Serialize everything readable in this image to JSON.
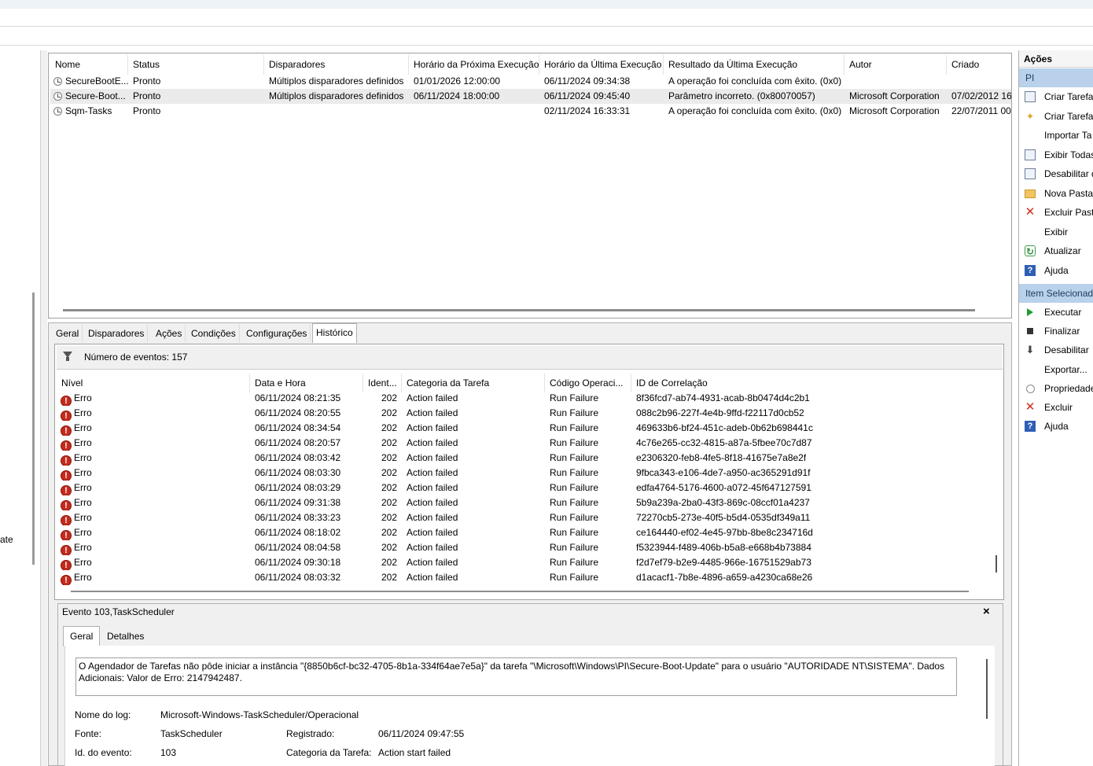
{
  "left_pane": {
    "partial_label": "ate"
  },
  "task_table": {
    "columns": [
      "Nome",
      "Status",
      "Disparadores",
      "Horário da Próxima Execução",
      "Horário da Última Execução",
      "Resultado da Última Execução",
      "Autor",
      "Criado"
    ],
    "rows": [
      {
        "name": "SecureBootE...",
        "status": "Pronto",
        "triggers": "Múltiplos disparadores definidos",
        "next_run": "01/01/2026 12:00:00",
        "last_run": "06/11/2024 09:34:38",
        "last_result": "A operação foi concluída com êxito. (0x0)",
        "author": "",
        "created": ""
      },
      {
        "name": "Secure-Boot...",
        "status": "Pronto",
        "triggers": "Múltiplos disparadores definidos",
        "next_run": "06/11/2024 18:00:00",
        "last_run": "06/11/2024 09:45:40",
        "last_result": "Parâmetro incorreto. (0x80070057)",
        "author": "Microsoft Corporation",
        "created": "07/02/2012 16:"
      },
      {
        "name": "Sqm-Tasks",
        "status": "Pronto",
        "triggers": "",
        "next_run": "",
        "last_run": "02/11/2024 16:33:31",
        "last_result": "A operação foi concluída com êxito. (0x0)",
        "author": "Microsoft Corporation",
        "created": "22/07/2011 00:"
      }
    ]
  },
  "detail_tabs": [
    "Geral",
    "Disparadores",
    "Ações",
    "Condições",
    "Configurações",
    "Histórico"
  ],
  "history": {
    "event_count_label": "Número de eventos: 157",
    "columns": [
      "Nível",
      "Data e Hora",
      "Ident...",
      "Categoria da Tarefa",
      "Código Operaci...",
      "ID de Correlação"
    ],
    "rows": [
      {
        "level": "Erro",
        "datetime": "06/11/2024 08:21:35",
        "id": "202",
        "category": "Action failed",
        "opcode": "Run Failure",
        "correlation": "8f36fcd7-ab74-4931-acab-8b0474d4c2b1"
      },
      {
        "level": "Erro",
        "datetime": "06/11/2024 08:20:55",
        "id": "202",
        "category": "Action failed",
        "opcode": "Run Failure",
        "correlation": "088c2b96-227f-4e4b-9ffd-f22117d0cb52"
      },
      {
        "level": "Erro",
        "datetime": "06/11/2024 08:34:54",
        "id": "202",
        "category": "Action failed",
        "opcode": "Run Failure",
        "correlation": "469633b6-bf24-451c-adeb-0b62b698441c"
      },
      {
        "level": "Erro",
        "datetime": "06/11/2024 08:20:57",
        "id": "202",
        "category": "Action failed",
        "opcode": "Run Failure",
        "correlation": "4c76e265-cc32-4815-a87a-5fbee70c7d87"
      },
      {
        "level": "Erro",
        "datetime": "06/11/2024 08:03:42",
        "id": "202",
        "category": "Action failed",
        "opcode": "Run Failure",
        "correlation": "e2306320-feb8-4fe5-8f18-41675e7a8e2f"
      },
      {
        "level": "Erro",
        "datetime": "06/11/2024 08:03:30",
        "id": "202",
        "category": "Action failed",
        "opcode": "Run Failure",
        "correlation": "9fbca343-e106-4de7-a950-ac365291d91f"
      },
      {
        "level": "Erro",
        "datetime": "06/11/2024 08:03:29",
        "id": "202",
        "category": "Action failed",
        "opcode": "Run Failure",
        "correlation": "edfa4764-5176-4600-a072-45f647127591"
      },
      {
        "level": "Erro",
        "datetime": "06/11/2024 09:31:38",
        "id": "202",
        "category": "Action failed",
        "opcode": "Run Failure",
        "correlation": "5b9a239a-2ba0-43f3-869c-08ccf01a4237"
      },
      {
        "level": "Erro",
        "datetime": "06/11/2024 08:33:23",
        "id": "202",
        "category": "Action failed",
        "opcode": "Run Failure",
        "correlation": "72270cb5-273e-40f5-b5d4-0535df349a11"
      },
      {
        "level": "Erro",
        "datetime": "06/11/2024 08:18:02",
        "id": "202",
        "category": "Action failed",
        "opcode": "Run Failure",
        "correlation": "ce164440-ef02-4e45-97bb-8be8c234716d"
      },
      {
        "level": "Erro",
        "datetime": "06/11/2024 08:04:58",
        "id": "202",
        "category": "Action failed",
        "opcode": "Run Failure",
        "correlation": "f5323944-f489-406b-b5a8-e668b4b73884"
      },
      {
        "level": "Erro",
        "datetime": "06/11/2024 09:30:18",
        "id": "202",
        "category": "Action failed",
        "opcode": "Run Failure",
        "correlation": "f2d7ef79-b2e9-4485-966e-16751529ab73"
      },
      {
        "level": "Erro",
        "datetime": "06/11/2024 08:03:32",
        "id": "202",
        "category": "Action failed",
        "opcode": "Run Failure",
        "correlation": "d1acacf1-7b8e-4896-a659-a4230ca68e26"
      }
    ]
  },
  "event_panel": {
    "title": "Evento 103,TaskScheduler",
    "close": "×",
    "tabs": [
      "Geral",
      "Detalhes"
    ],
    "message": "O Agendador de Tarefas não pôde iniciar a instância \"{8850b6cf-bc32-4705-8b1a-334f64ae7e5a}\" da tarefa \"\\Microsoft\\Windows\\PI\\Secure-Boot-Update\" para o usuário \"AUTORIDADE NT\\SISTEMA\". Dados Adicionais: Valor de Erro: 2147942487.",
    "log_name_label": "Nome do log:",
    "log_name": "Microsoft-Windows-TaskScheduler/Operacional",
    "source_label": "Fonte:",
    "source": "TaskScheduler",
    "logged_label": "Registrado:",
    "logged": "06/11/2024 09:47:55",
    "event_id_label": "Id. do evento:",
    "event_id": "103",
    "task_category_label": "Categoria da Tarefa:",
    "task_category": "Action start failed"
  },
  "actions_pane": {
    "header": "Ações",
    "section1": "PI",
    "section1_items": [
      {
        "label": "Criar Tarefa",
        "icon": "task-icon"
      },
      {
        "label": "Criar Tarefa...",
        "icon": "wizard-icon"
      },
      {
        "label": "Importar Ta",
        "icon": ""
      },
      {
        "label": "Exibir Todas",
        "icon": "list-icon"
      },
      {
        "label": "Desabilitar d",
        "icon": "log-icon"
      },
      {
        "label": "Nova Pasta...",
        "icon": "folder-icon"
      },
      {
        "label": "Excluir Pasta",
        "icon": "delete-icon"
      },
      {
        "label": "Exibir",
        "icon": ""
      },
      {
        "label": "Atualizar",
        "icon": "refresh-icon"
      },
      {
        "label": "Ajuda",
        "icon": "help-icon"
      }
    ],
    "section2": "Item Selecionado",
    "section2_items": [
      {
        "label": "Executar",
        "icon": "run-icon"
      },
      {
        "label": "Finalizar",
        "icon": "stop-icon"
      },
      {
        "label": "Desabilitar",
        "icon": "disable-icon"
      },
      {
        "label": "Exportar...",
        "icon": ""
      },
      {
        "label": "Propriedade",
        "icon": "properties-icon"
      },
      {
        "label": "Excluir",
        "icon": "delete-icon"
      },
      {
        "label": "Ajuda",
        "icon": "help-icon"
      }
    ]
  }
}
